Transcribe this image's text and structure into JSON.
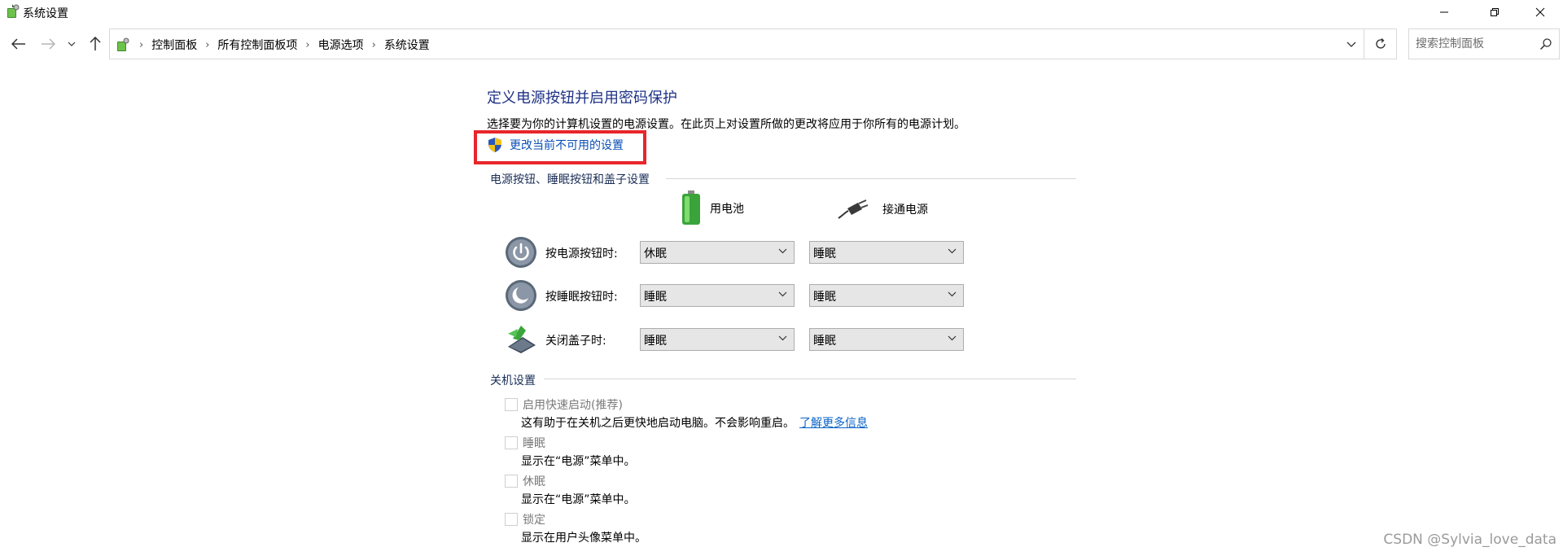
{
  "window": {
    "title": "系统设置"
  },
  "address": {
    "crumbs": [
      "控制面板",
      "所有控制面板项",
      "电源选项",
      "系统设置"
    ],
    "search_placeholder": "搜索控制面板"
  },
  "main": {
    "heading": "定义电源按钮并启用密码保护",
    "description": "选择要为你的计算机设置的电源设置。在此页上对设置所做的更改将应用于你所有的电源计划。",
    "change_link": "更改当前不可用的设置"
  },
  "buttons_section": {
    "title": "电源按钮、睡眠按钮和盖子设置",
    "col_battery": "用电池",
    "col_plugged": "接通电源",
    "rows": [
      {
        "label": "按电源按钮时:",
        "battery": "休眠",
        "plugged": "睡眠"
      },
      {
        "label": "按睡眠按钮时:",
        "battery": "睡眠",
        "plugged": "睡眠"
      },
      {
        "label": "关闭盖子时:",
        "battery": "睡眠",
        "plugged": "睡眠"
      }
    ]
  },
  "shutdown_section": {
    "title": "关机设置",
    "items": [
      {
        "label": "启用快速启动(推荐)",
        "desc": "这有助于在关机之后更快地启动电脑。不会影响重启。",
        "link": "了解更多信息",
        "checked": false,
        "enabled": false
      },
      {
        "label": "睡眠",
        "desc": "显示在“电源”菜单中。",
        "checked": false,
        "enabled": false
      },
      {
        "label": "休眠",
        "desc": "显示在“电源”菜单中。",
        "checked": false,
        "enabled": false
      },
      {
        "label": "锁定",
        "desc": "显示在用户头像菜单中。",
        "checked": false,
        "enabled": false
      }
    ]
  },
  "watermark": "CSDN @Sylvia_love_data",
  "colors": {
    "heading": "#1e3287",
    "link": "#0a4fb5",
    "highlight_box": "#e8262b"
  }
}
